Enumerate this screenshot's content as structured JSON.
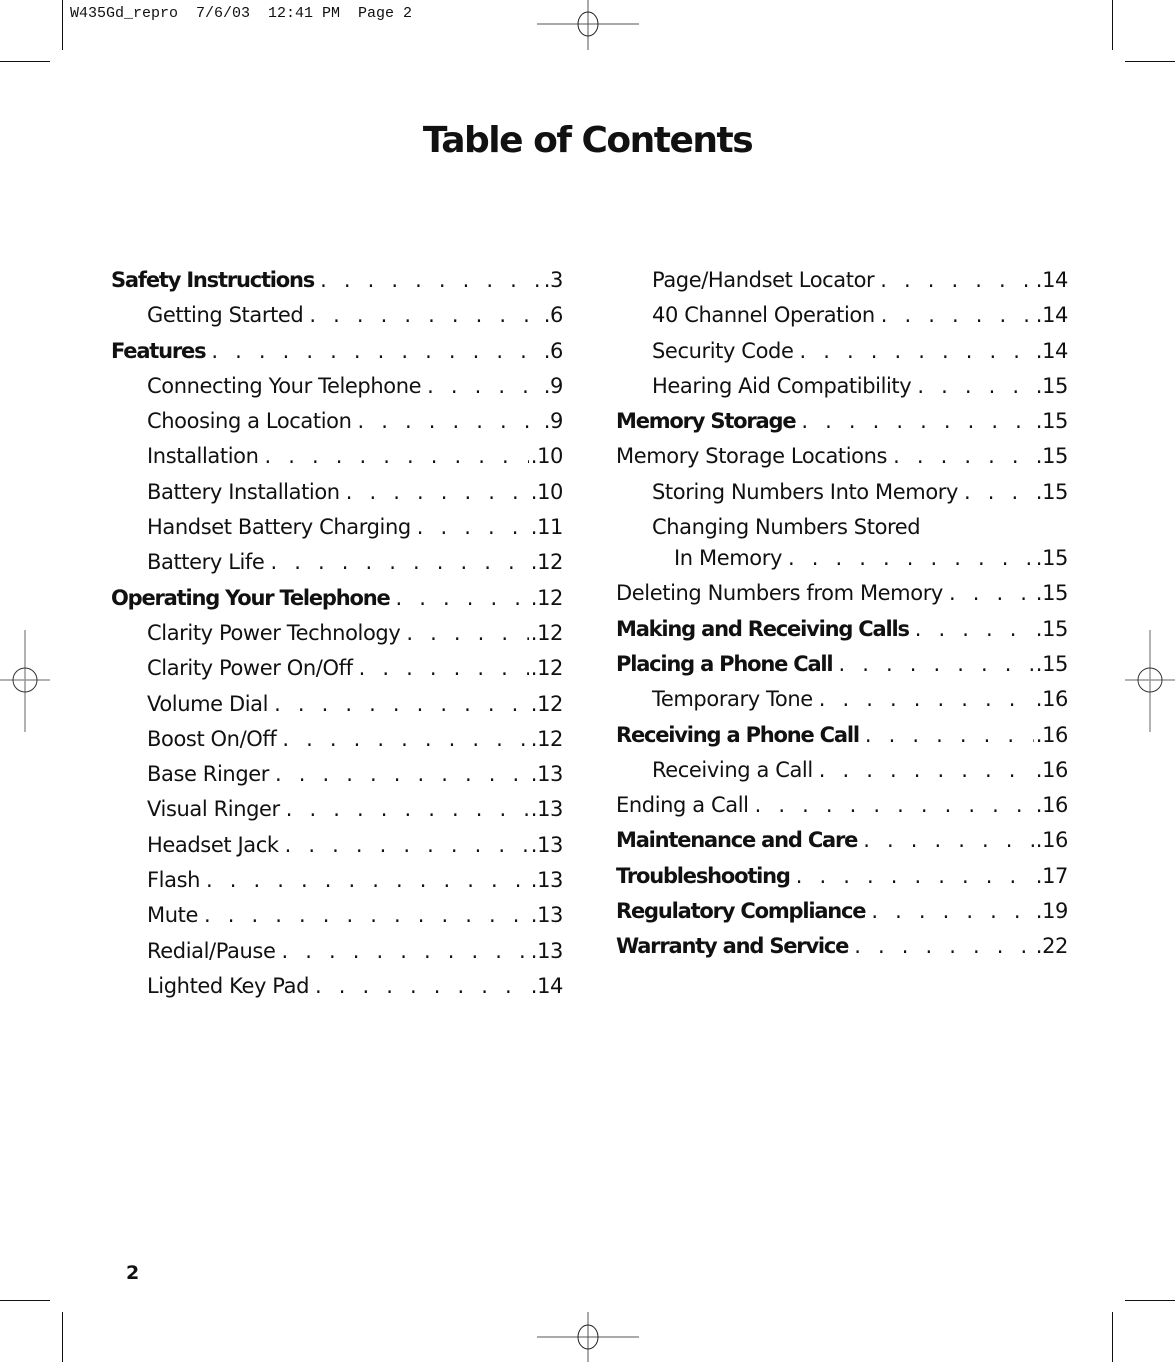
{
  "slug": "W435Gd_repro  7/6/03  12:41 PM  Page 2",
  "title": "Table of Contents",
  "page_number": "2",
  "toc": {
    "left": [
      {
        "label": "Safety Instructions",
        "page": ".3",
        "bold": true,
        "level": 0
      },
      {
        "label": "Getting Started",
        "page": ".6",
        "bold": false,
        "level": 1
      },
      {
        "label": "Features",
        "page": ".6",
        "bold": true,
        "level": 0
      },
      {
        "label": "Connecting Your Telephone",
        "page": ".9",
        "bold": false,
        "level": 1
      },
      {
        "label": "Choosing a Location",
        "page": ".9",
        "bold": false,
        "level": 1
      },
      {
        "label": "Installation",
        "page": ".10",
        "bold": false,
        "level": 1
      },
      {
        "label": "Battery Installation",
        "page": ".10",
        "bold": false,
        "level": 1
      },
      {
        "label": "Handset Battery Charging",
        "page": ".11",
        "bold": false,
        "level": 1
      },
      {
        "label": "Battery Life",
        "page": ".12",
        "bold": false,
        "level": 1
      },
      {
        "label": "Operating Your Telephone",
        "page": ".12",
        "bold": true,
        "level": 0
      },
      {
        "label": "Clarity Power Technology",
        "page": ".12",
        "bold": false,
        "level": 1
      },
      {
        "label": "Clarity Power On/Off",
        "page": ".12",
        "bold": false,
        "level": 1
      },
      {
        "label": "Volume Dial",
        "page": ".12",
        "bold": false,
        "level": 1
      },
      {
        "label": "Boost On/Off",
        "page": ".12",
        "bold": false,
        "level": 1
      },
      {
        "label": "Base Ringer",
        "page": ".13",
        "bold": false,
        "level": 1
      },
      {
        "label": "Visual Ringer",
        "page": ".13",
        "bold": false,
        "level": 1
      },
      {
        "label": "Headset Jack",
        "page": ".13",
        "bold": false,
        "level": 1
      },
      {
        "label": "Flash",
        "page": ".13",
        "bold": false,
        "level": 1
      },
      {
        "label": "Mute",
        "page": ".13",
        "bold": false,
        "level": 1
      },
      {
        "label": "Redial/Pause",
        "page": ".13",
        "bold": false,
        "level": 1
      },
      {
        "label": "Lighted Key Pad",
        "page": ".14",
        "bold": false,
        "level": 1
      }
    ],
    "right": [
      {
        "label": "Page/Handset Locator",
        "page": ".14",
        "bold": false,
        "level": 1
      },
      {
        "label": "40 Channel Operation",
        "page": ".14",
        "bold": false,
        "level": 1
      },
      {
        "label": "Security Code",
        "page": ".14",
        "bold": false,
        "level": 1
      },
      {
        "label": "Hearing Aid Compatibility",
        "page": ".15",
        "bold": false,
        "level": 1
      },
      {
        "label": "Memory Storage",
        "page": ".15",
        "bold": true,
        "level": 0
      },
      {
        "label": "Memory Storage Locations",
        "page": ".15",
        "bold": false,
        "level": 0
      },
      {
        "label": "Storing Numbers Into Memory",
        "page": ".15",
        "bold": false,
        "level": 1
      },
      {
        "label": "Changing Numbers Stored",
        "page": "",
        "bold": false,
        "level": 1,
        "continued": true
      },
      {
        "label": "In Memory",
        "page": ".15",
        "bold": false,
        "level": 2
      },
      {
        "label": "Deleting Numbers from Memory",
        "page": ".15",
        "bold": false,
        "level": 0
      },
      {
        "label": "Making and Receiving Calls",
        "page": ".15",
        "bold": true,
        "level": 0
      },
      {
        "label": "Placing a Phone Call",
        "page": ".15",
        "bold": true,
        "level": 0
      },
      {
        "label": "Temporary Tone",
        "page": ".16",
        "bold": false,
        "level": 1
      },
      {
        "label": "Receiving a Phone Call",
        "page": ".16",
        "bold": true,
        "level": 0
      },
      {
        "label": "Receiving a Call",
        "page": ".16",
        "bold": false,
        "level": 1
      },
      {
        "label": "Ending a Call",
        "page": ".16",
        "bold": false,
        "level": 0
      },
      {
        "label": "Maintenance and Care",
        "page": ".16",
        "bold": true,
        "level": 0
      },
      {
        "label": "Troubleshooting",
        "page": ".17",
        "bold": true,
        "level": 0
      },
      {
        "label": "Regulatory Compliance",
        "page": ".19",
        "bold": true,
        "level": 0
      },
      {
        "label": "Warranty and Service",
        "page": ".22",
        "bold": true,
        "level": 0
      }
    ]
  }
}
